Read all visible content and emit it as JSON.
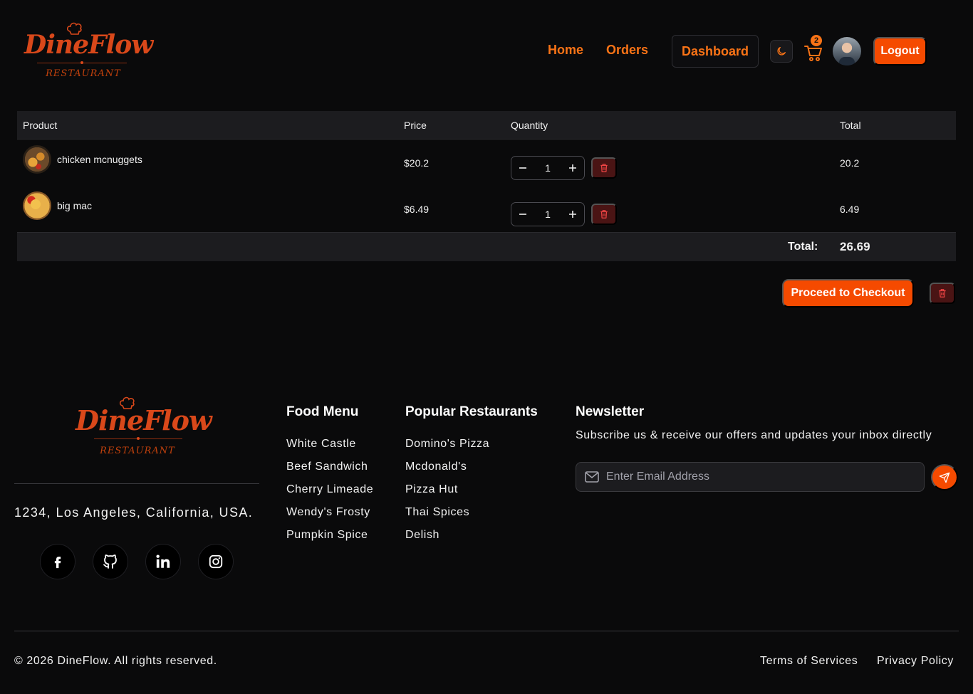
{
  "brand": {
    "name": "DineFlow",
    "tagline": "RESTAURANT",
    "accent": "#f97316",
    "button_color": "#f54a00"
  },
  "header": {
    "nav": [
      {
        "label": "Home"
      },
      {
        "label": "Orders"
      },
      {
        "label": "Dashboard"
      }
    ],
    "theme_icon": "moon-icon",
    "cart_icon": "cart-icon",
    "cart_count": "2",
    "logout_label": "Logout"
  },
  "cart": {
    "columns": {
      "product": "Product",
      "price": "Price",
      "quantity": "Quantity",
      "total": "Total"
    },
    "items": [
      {
        "name": "chicken mcnuggets",
        "price": "$20.2",
        "quantity": "1",
        "total": "20.2"
      },
      {
        "name": "big mac",
        "price": "$6.49",
        "quantity": "1",
        "total": "6.49"
      }
    ],
    "total_label": "Total:",
    "total_value": "26.69",
    "checkout_label": "Proceed to Checkout"
  },
  "footer": {
    "address": "1234, Los Angeles, California, USA.",
    "socials": [
      "facebook-icon",
      "github-icon",
      "linkedin-icon",
      "instagram-icon"
    ],
    "food_menu": {
      "title": "Food Menu",
      "items": [
        "White Castle",
        "Beef Sandwich",
        "Cherry Limeade",
        "Wendy's Frosty",
        "Pumpkin Spice"
      ]
    },
    "restaurants": {
      "title": "Popular Restaurants",
      "items": [
        "Domino's Pizza",
        "Mcdonald's",
        "Pizza Hut",
        "Thai Spices",
        "Delish"
      ]
    },
    "newsletter": {
      "title": "Newsletter",
      "text": "Subscribe us & receive our offers and updates your inbox directly",
      "placeholder": "Enter Email Address"
    },
    "copyright": "© 2026 DineFlow. All rights reserved.",
    "terms": "Terms of Services",
    "privacy": "Privacy Policy"
  }
}
